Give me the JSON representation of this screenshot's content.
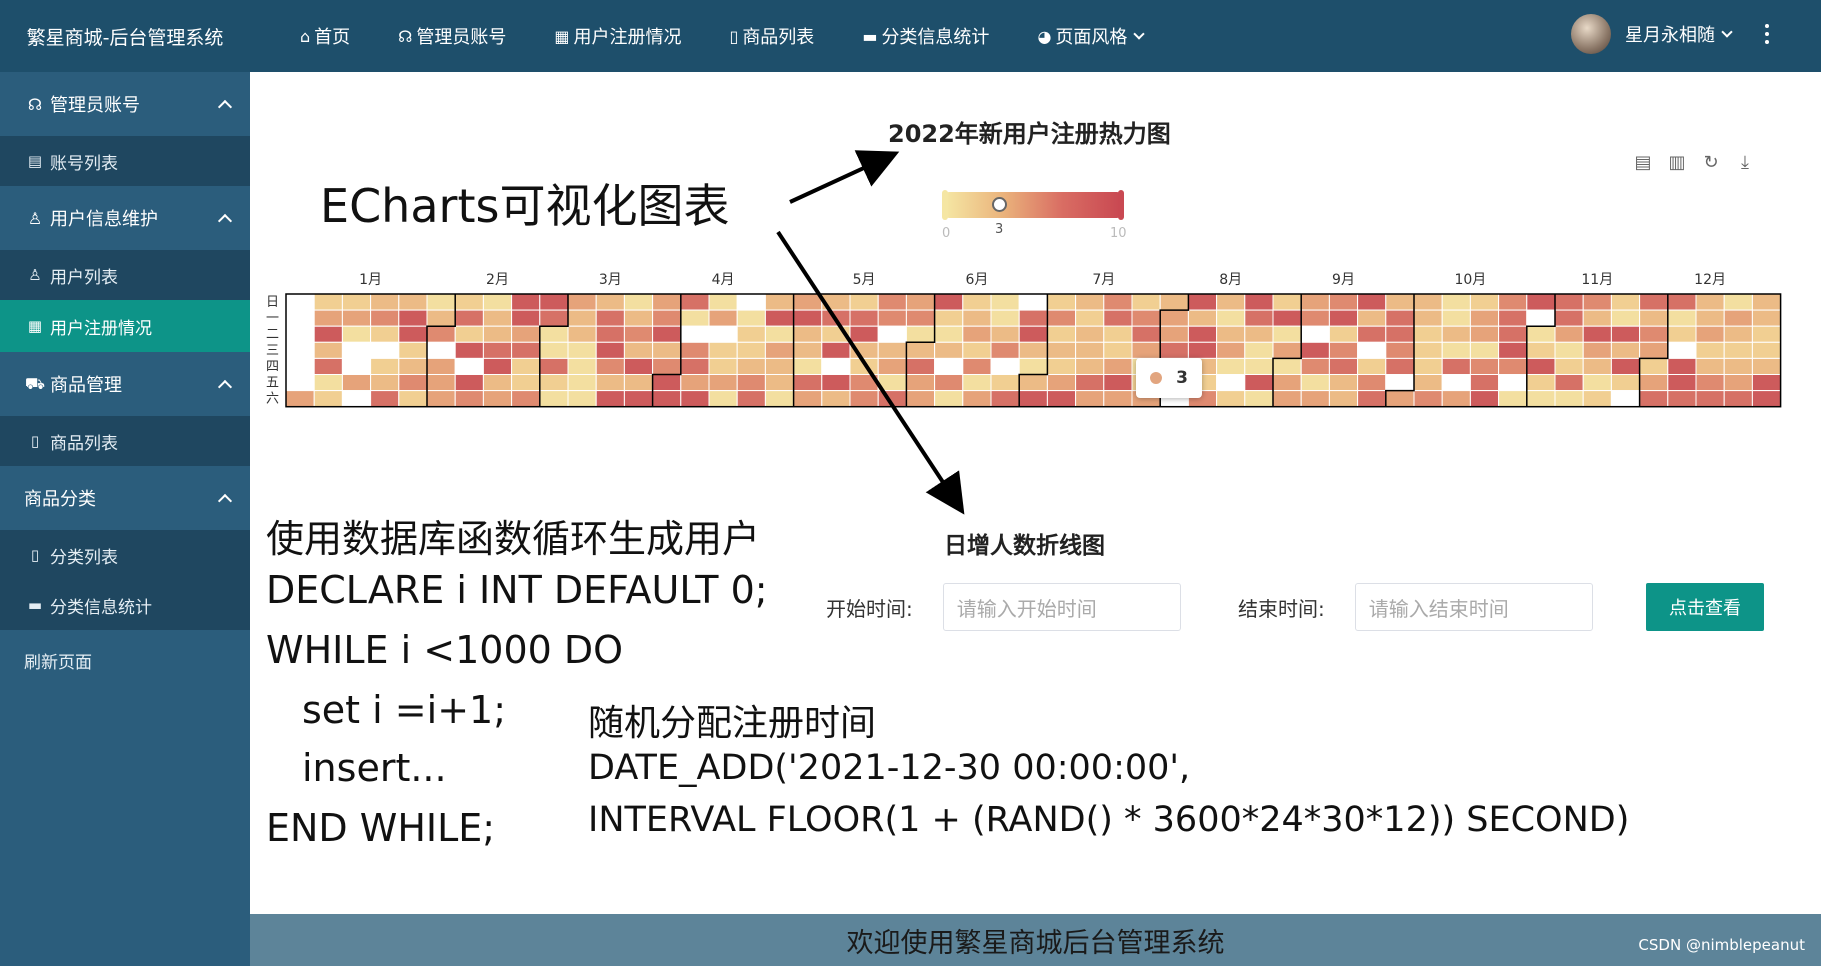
{
  "app": {
    "brand": "繁星商城-后台管理系统"
  },
  "sidebar": {
    "groups": [
      {
        "label": "管理员账号",
        "icon": "headset-icon",
        "items": [
          {
            "label": "账号列表",
            "icon": "list-icon"
          }
        ]
      },
      {
        "label": "用户信息维护",
        "icon": "user-icon",
        "items": [
          {
            "label": "用户列表",
            "icon": "users-icon"
          },
          {
            "label": "用户注册情况",
            "icon": "grid-icon",
            "active": true
          }
        ]
      },
      {
        "label": "商品管理",
        "icon": "cart-icon",
        "items": [
          {
            "label": "商品列表",
            "icon": "document-icon"
          }
        ]
      },
      {
        "label": "商品分类",
        "icon": "",
        "items": [
          {
            "label": "分类列表",
            "icon": "file-icon"
          },
          {
            "label": "分类信息统计",
            "icon": "monitor-icon"
          }
        ]
      }
    ],
    "refresh": "刷新页面"
  },
  "topnav": {
    "items": [
      {
        "label": "首页",
        "icon": "home-icon"
      },
      {
        "label": "管理员账号",
        "icon": "headset-icon"
      },
      {
        "label": "用户注册情况",
        "icon": "grid-icon"
      },
      {
        "label": "商品列表",
        "icon": "document-icon"
      },
      {
        "label": "分类信息统计",
        "icon": "monitor-icon"
      },
      {
        "label": "页面风格",
        "icon": "palette-icon"
      }
    ],
    "user": "星月永相随"
  },
  "heatmap": {
    "title": "2022年新用户注册热力图",
    "months": [
      "1月",
      "2月",
      "3月",
      "4月",
      "5月",
      "6月",
      "7月",
      "8月",
      "9月",
      "10月",
      "11月",
      "12月"
    ],
    "weekdays": [
      "日",
      "一",
      "二",
      "三",
      "四",
      "五",
      "六"
    ],
    "visualmap": {
      "min": "0",
      "max": "10",
      "value": "3"
    },
    "tooltip_value": "3",
    "colors": {
      "low": "#f5e6a3",
      "mid": "#e8a978",
      "high": "#c94952"
    }
  },
  "chart_data": {
    "type": "heatmap",
    "title": "2022年新用户注册热力图",
    "calendar_range": "2022",
    "visualmap_range": [
      0,
      10
    ],
    "tooltip_value": 3
  },
  "annotations": {
    "echarts": "ECharts可视化图表",
    "code_lines": [
      "使用数据库函数循环生成用户",
      "DECLARE i INT DEFAULT 0;",
      "WHILE i <1000 DO",
      "set i =i+1;",
      "insert...",
      "END WHILE;"
    ],
    "code_right": [
      "随机分配注册时间",
      "DATE_ADD('2021-12-30 00:00:00',",
      "INTERVAL FLOOR(1 + (RAND() * 3600*24*30*12)) SECOND)"
    ]
  },
  "linechart": {
    "title": "日增人数折线图",
    "start_label": "开始时间:",
    "start_placeholder": "请输入开始时间",
    "end_label": "结束时间:",
    "end_placeholder": "请输入结束时间",
    "button": "点击查看"
  },
  "footer": {
    "text": "欢迎使用繁星商城后台管理系统",
    "watermark": "CSDN @nimblepeanut"
  }
}
